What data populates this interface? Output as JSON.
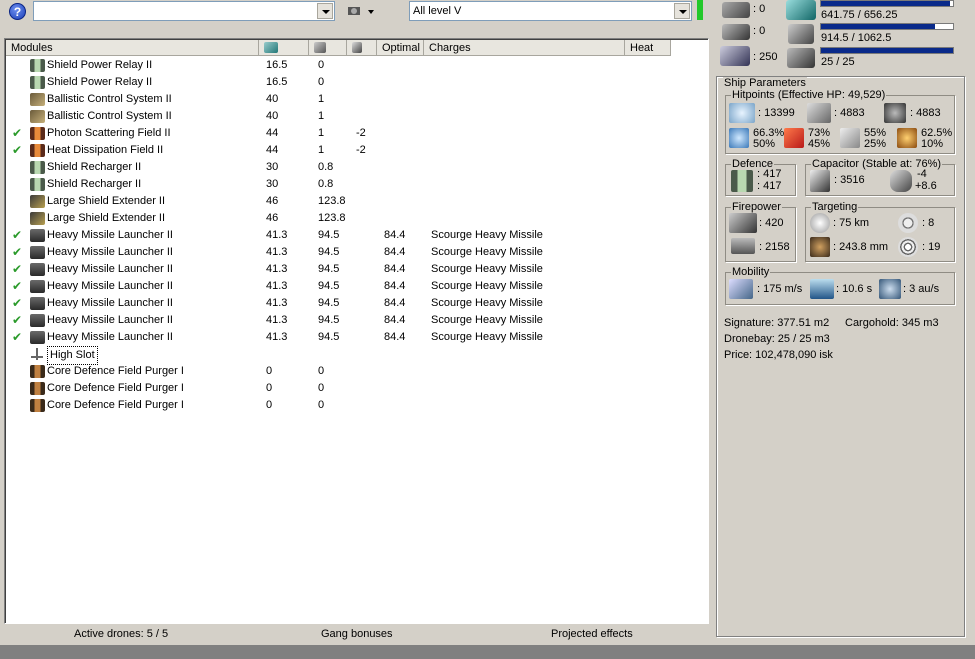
{
  "toolbar": {
    "help_icon": "question-icon",
    "search_value": "",
    "skills_select": "All level V"
  },
  "resources": {
    "turret_hardpoints": ": 0",
    "launcher_hardpoints": ": 0",
    "calibration": ": 250",
    "cpu": "641.75 / 656.25",
    "cpu_fraction": 0.978,
    "powergrid": "914.5 / 1062.5",
    "powergrid_fraction": 0.861,
    "drone_bandwidth": "25 / 25",
    "drone_bandwidth_fraction": 1.0
  },
  "modules_table": {
    "headers": [
      "Modules",
      "",
      "",
      "",
      "Optimal",
      "Charges",
      "Heat"
    ],
    "header_icons": [
      "cpu-icon",
      "powergrid-icon",
      "capacitor-icon"
    ],
    "rows": [
      {
        "checked": false,
        "icon": "shield-power-relay-icon",
        "name": "Shield Power Relay II",
        "cpu": "16.5",
        "pg": "0",
        "cap": "",
        "optimal": "",
        "charges": ""
      },
      {
        "checked": false,
        "icon": "shield-power-relay-icon",
        "name": "Shield Power Relay II",
        "cpu": "16.5",
        "pg": "0",
        "cap": "",
        "optimal": "",
        "charges": ""
      },
      {
        "checked": false,
        "icon": "ballistic-control-icon",
        "name": "Ballistic Control System II",
        "cpu": "40",
        "pg": "1",
        "cap": "",
        "optimal": "",
        "charges": ""
      },
      {
        "checked": false,
        "icon": "ballistic-control-icon",
        "name": "Ballistic Control System II",
        "cpu": "40",
        "pg": "1",
        "cap": "",
        "optimal": "",
        "charges": ""
      },
      {
        "checked": true,
        "icon": "hardener-icon",
        "name": "Photon Scattering Field II",
        "cpu": "44",
        "pg": "1",
        "cap": "-2",
        "optimal": "",
        "charges": ""
      },
      {
        "checked": true,
        "icon": "hardener-icon",
        "name": "Heat Dissipation Field II",
        "cpu": "44",
        "pg": "1",
        "cap": "-2",
        "optimal": "",
        "charges": ""
      },
      {
        "checked": false,
        "icon": "shield-recharger-icon",
        "name": "Shield Recharger II",
        "cpu": "30",
        "pg": "0.8",
        "cap": "",
        "optimal": "",
        "charges": ""
      },
      {
        "checked": false,
        "icon": "shield-recharger-icon",
        "name": "Shield Recharger II",
        "cpu": "30",
        "pg": "0.8",
        "cap": "",
        "optimal": "",
        "charges": ""
      },
      {
        "checked": false,
        "icon": "shield-extender-icon",
        "name": "Large Shield Extender II",
        "cpu": "46",
        "pg": "123.8",
        "cap": "",
        "optimal": "",
        "charges": ""
      },
      {
        "checked": false,
        "icon": "shield-extender-icon",
        "name": "Large Shield Extender II",
        "cpu": "46",
        "pg": "123.8",
        "cap": "",
        "optimal": "",
        "charges": ""
      },
      {
        "checked": true,
        "icon": "missile-launcher-icon",
        "name": "Heavy Missile Launcher II",
        "cpu": "41.3",
        "pg": "94.5",
        "cap": "",
        "optimal": "84.4",
        "charges": "Scourge Heavy Missile"
      },
      {
        "checked": true,
        "icon": "missile-launcher-icon",
        "name": "Heavy Missile Launcher II",
        "cpu": "41.3",
        "pg": "94.5",
        "cap": "",
        "optimal": "84.4",
        "charges": "Scourge Heavy Missile"
      },
      {
        "checked": true,
        "icon": "missile-launcher-icon",
        "name": "Heavy Missile Launcher II",
        "cpu": "41.3",
        "pg": "94.5",
        "cap": "",
        "optimal": "84.4",
        "charges": "Scourge Heavy Missile"
      },
      {
        "checked": true,
        "icon": "missile-launcher-icon",
        "name": "Heavy Missile Launcher II",
        "cpu": "41.3",
        "pg": "94.5",
        "cap": "",
        "optimal": "84.4",
        "charges": "Scourge Heavy Missile"
      },
      {
        "checked": true,
        "icon": "missile-launcher-icon",
        "name": "Heavy Missile Launcher II",
        "cpu": "41.3",
        "pg": "94.5",
        "cap": "",
        "optimal": "84.4",
        "charges": "Scourge Heavy Missile"
      },
      {
        "checked": true,
        "icon": "missile-launcher-icon",
        "name": "Heavy Missile Launcher II",
        "cpu": "41.3",
        "pg": "94.5",
        "cap": "",
        "optimal": "84.4",
        "charges": "Scourge Heavy Missile"
      },
      {
        "checked": true,
        "icon": "missile-launcher-icon",
        "name": "Heavy Missile Launcher II",
        "cpu": "41.3",
        "pg": "94.5",
        "cap": "",
        "optimal": "84.4",
        "charges": "Scourge Heavy Missile"
      },
      {
        "checked": false,
        "icon": "high-slot-icon",
        "name": "High Slot",
        "cpu": "",
        "pg": "",
        "cap": "",
        "optimal": "",
        "charges": "",
        "empty_slot": true
      },
      {
        "checked": false,
        "icon": "rig-icon",
        "name": "Core Defence Field Purger I",
        "cpu": "0",
        "pg": "0",
        "cap": "",
        "optimal": "",
        "charges": ""
      },
      {
        "checked": false,
        "icon": "rig-icon",
        "name": "Core Defence Field Purger I",
        "cpu": "0",
        "pg": "0",
        "cap": "",
        "optimal": "",
        "charges": ""
      },
      {
        "checked": false,
        "icon": "rig-icon",
        "name": "Core Defence Field Purger I",
        "cpu": "0",
        "pg": "0",
        "cap": "",
        "optimal": "",
        "charges": ""
      }
    ]
  },
  "statusbar": {
    "active_drones": "Active drones: 5 / 5",
    "gang_bonuses": "Gang bonuses",
    "projected_effects": "Projected effects"
  },
  "ship_parameters": {
    "title": "Ship Parameters",
    "hitpoints": {
      "label": "Hitpoints (Effective HP: 49,529)",
      "shield": ": 13399",
      "armor": ": 4883",
      "structure": ": 4883",
      "em_top": "66.3%",
      "em_bottom": "50%",
      "thermal_top": "73%",
      "thermal_bottom": "45%",
      "kinetic_top": "55%",
      "kinetic_bottom": "25%",
      "explosive_top": "62.5%",
      "explosive_bottom": "10%"
    },
    "defence": {
      "label": "Defence",
      "top": ": 417",
      "bottom": ": 417"
    },
    "capacitor": {
      "label": "Capacitor (Stable at: 76%)",
      "capacity": ": 3516",
      "delta_top": "-4",
      "delta_bottom": "+8.6"
    },
    "firepower": {
      "label": "Firepower",
      "volley": ": 420",
      "dps": ": 2158"
    },
    "targeting": {
      "label": "Targeting",
      "range": ": 75 km",
      "max_targets": ": 8",
      "scan_res": ": 243.8 mm",
      "sensor_strength": ": 19"
    },
    "mobility": {
      "label": "Mobility",
      "speed": ": 175 m/s",
      "align": ": 10.6 s",
      "warp": ": 3 au/s"
    },
    "signature": "Signature: 377.51 m2",
    "cargohold": "Cargohold: 345 m3",
    "dronebay": "Dronebay: 25 / 25 m3",
    "price": "Price: 102,478,090 isk"
  },
  "colors": {
    "window_bg": "#d4d0c8",
    "resource_bar": "#0a2a8a",
    "active_indicator": "#22c82a",
    "check_mark": "#2a9a2a"
  }
}
